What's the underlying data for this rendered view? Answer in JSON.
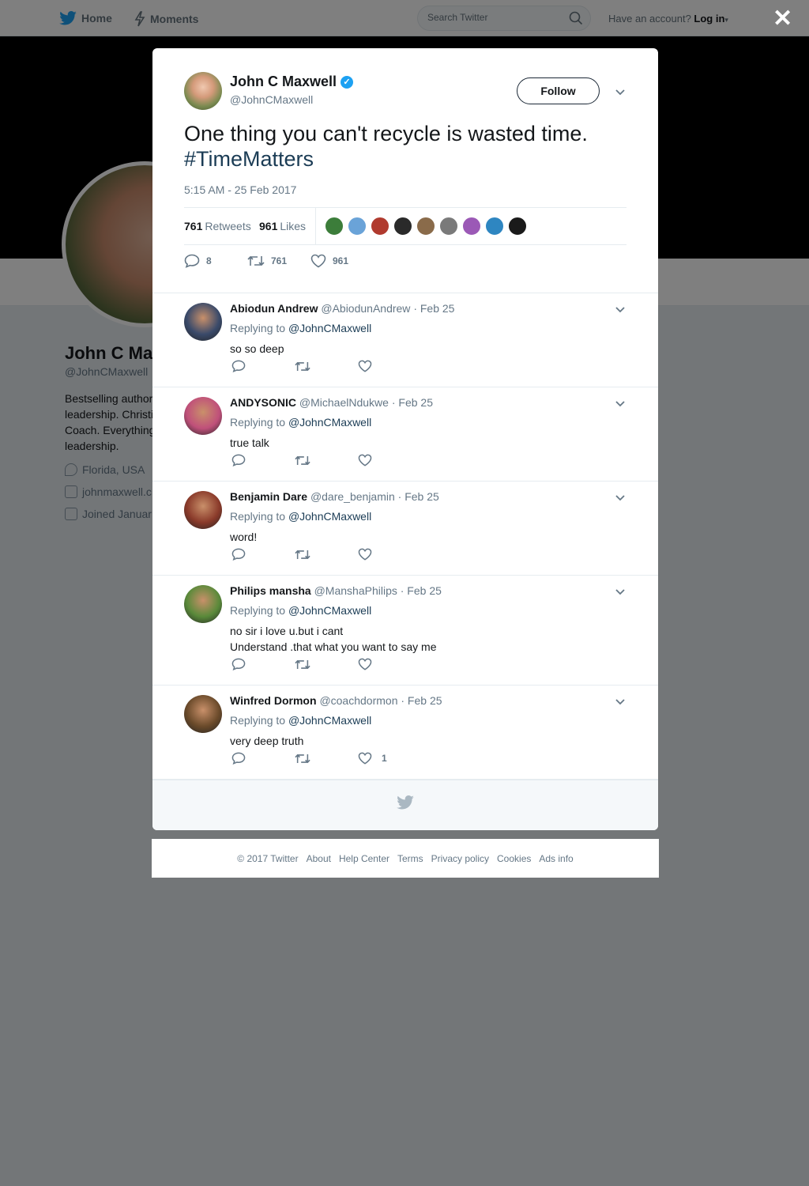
{
  "nav": {
    "home_label": "Home",
    "moments_label": "Moments",
    "search_placeholder": "Search Twitter",
    "have_account": "Have an account?",
    "login_label": "Log in"
  },
  "profile": {
    "name": "John C Max",
    "handle": "@JohnCMaxwell",
    "bio": "Bestselling author\nleadership. Christi\nCoach. Everything\nleadership.",
    "location": "Florida, USA",
    "website": "johnmaxwell.c",
    "joined": "Joined Januar"
  },
  "tweet": {
    "author_name": "John C Maxwell",
    "author_handle": "@JohnCMaxwell",
    "follow_label": "Follow",
    "text": "One thing you can't recycle is wasted time.",
    "hashtag": "#TimeMatters",
    "timestamp": "5:15 AM - 25 Feb 2017",
    "retweets_count": "761",
    "retweets_label": "Retweets",
    "likes_count": "961",
    "likes_label": "Likes",
    "reply_count": "8",
    "retweet_count": "761",
    "like_count": "961",
    "liker_colors": [
      "#3c7d3a",
      "#6aa3d8",
      "#b03a2e",
      "#2a2a2a",
      "#8a6b4a",
      "#7a7a7a",
      "#9b59b6",
      "#2e86c1",
      "#1a1a1a"
    ]
  },
  "replies": [
    {
      "name": "Abiodun Andrew",
      "handle": "@AbiodunAndrew",
      "date": "· Feb 25",
      "replying": "Replying to",
      "mention": "@JohnCMaxwell",
      "text": "so so deep",
      "likes": "",
      "avatar_color": "#3a4a6a"
    },
    {
      "name": "ANDYSONIC",
      "handle": "@MichaelNdukwe",
      "date": "· Feb 25",
      "replying": "Replying to",
      "mention": "@JohnCMaxwell",
      "text": "true talk",
      "likes": "",
      "avatar_color": "#c0507a"
    },
    {
      "name": "Benjamin Dare",
      "handle": "@dare_benjamin",
      "date": "· Feb 25",
      "replying": "Replying to",
      "mention": "@JohnCMaxwell",
      "text": "word!",
      "likes": "",
      "avatar_color": "#8a3a2a"
    },
    {
      "name": "Philips mansha",
      "handle": "@ManshaPhilips",
      "date": "· Feb 25",
      "replying": "Replying to",
      "mention": "@JohnCMaxwell",
      "text": "no sir i love u.but i cant\nUnderstand .that what you want to say me",
      "likes": "",
      "avatar_color": "#5a8a3a"
    },
    {
      "name": "Winfred Dormon",
      "handle": "@coachdormon",
      "date": "· Feb 25",
      "replying": "Replying to",
      "mention": "@JohnCMaxwell",
      "text": "very deep truth",
      "likes": "1",
      "avatar_color": "#6a4a2a"
    }
  ],
  "footer": {
    "copyright": "© 2017 Twitter",
    "about": "About",
    "help": "Help Center",
    "terms": "Terms",
    "privacy": "Privacy policy",
    "cookies": "Cookies",
    "ads": "Ads info"
  },
  "colors": {
    "accent": "#1da1f2",
    "overlay": "#74787c"
  }
}
